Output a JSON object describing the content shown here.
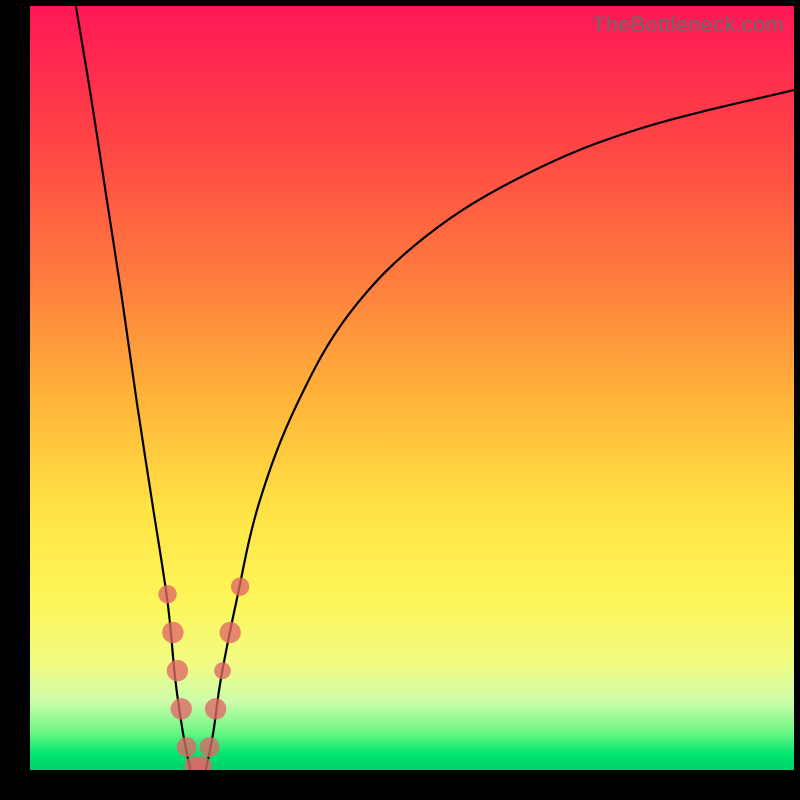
{
  "watermark": "TheBottleneck.com",
  "colors": {
    "top": "#ff1757",
    "bottom": "#00d268",
    "curve": "#000000",
    "dots": "#e06666",
    "frame_bg": "#000000"
  },
  "chart_data": {
    "type": "line",
    "title": "",
    "xlabel": "",
    "ylabel": "",
    "xlim": [
      0,
      100
    ],
    "ylim": [
      0,
      100
    ],
    "left_branch": {
      "name": "left",
      "points": [
        {
          "x": 6,
          "y": 100
        },
        {
          "x": 8,
          "y": 88
        },
        {
          "x": 10,
          "y": 75
        },
        {
          "x": 12,
          "y": 62
        },
        {
          "x": 14,
          "y": 48
        },
        {
          "x": 16,
          "y": 35
        },
        {
          "x": 18,
          "y": 22
        },
        {
          "x": 19,
          "y": 12
        },
        {
          "x": 20,
          "y": 5
        },
        {
          "x": 21,
          "y": 0
        }
      ]
    },
    "right_branch": {
      "name": "right",
      "points": [
        {
          "x": 23,
          "y": 0
        },
        {
          "x": 24,
          "y": 5
        },
        {
          "x": 25,
          "y": 12
        },
        {
          "x": 27,
          "y": 22
        },
        {
          "x": 30,
          "y": 35
        },
        {
          "x": 35,
          "y": 48
        },
        {
          "x": 42,
          "y": 60
        },
        {
          "x": 52,
          "y": 70
        },
        {
          "x": 65,
          "y": 78
        },
        {
          "x": 80,
          "y": 84
        },
        {
          "x": 100,
          "y": 89
        }
      ]
    },
    "markers": [
      {
        "x": 18.0,
        "y": 23,
        "r": 1.2
      },
      {
        "x": 18.7,
        "y": 18,
        "r": 1.4
      },
      {
        "x": 19.3,
        "y": 13,
        "r": 1.4
      },
      {
        "x": 19.8,
        "y": 8,
        "r": 1.4
      },
      {
        "x": 20.5,
        "y": 3,
        "r": 1.3
      },
      {
        "x": 21.5,
        "y": 0.5,
        "r": 1.3
      },
      {
        "x": 22.5,
        "y": 0.5,
        "r": 1.3
      },
      {
        "x": 23.5,
        "y": 3,
        "r": 1.3
      },
      {
        "x": 24.3,
        "y": 8,
        "r": 1.4
      },
      {
        "x": 25.2,
        "y": 13,
        "r": 1.1
      },
      {
        "x": 26.2,
        "y": 18,
        "r": 1.4
      },
      {
        "x": 27.5,
        "y": 24,
        "r": 1.2
      }
    ]
  }
}
